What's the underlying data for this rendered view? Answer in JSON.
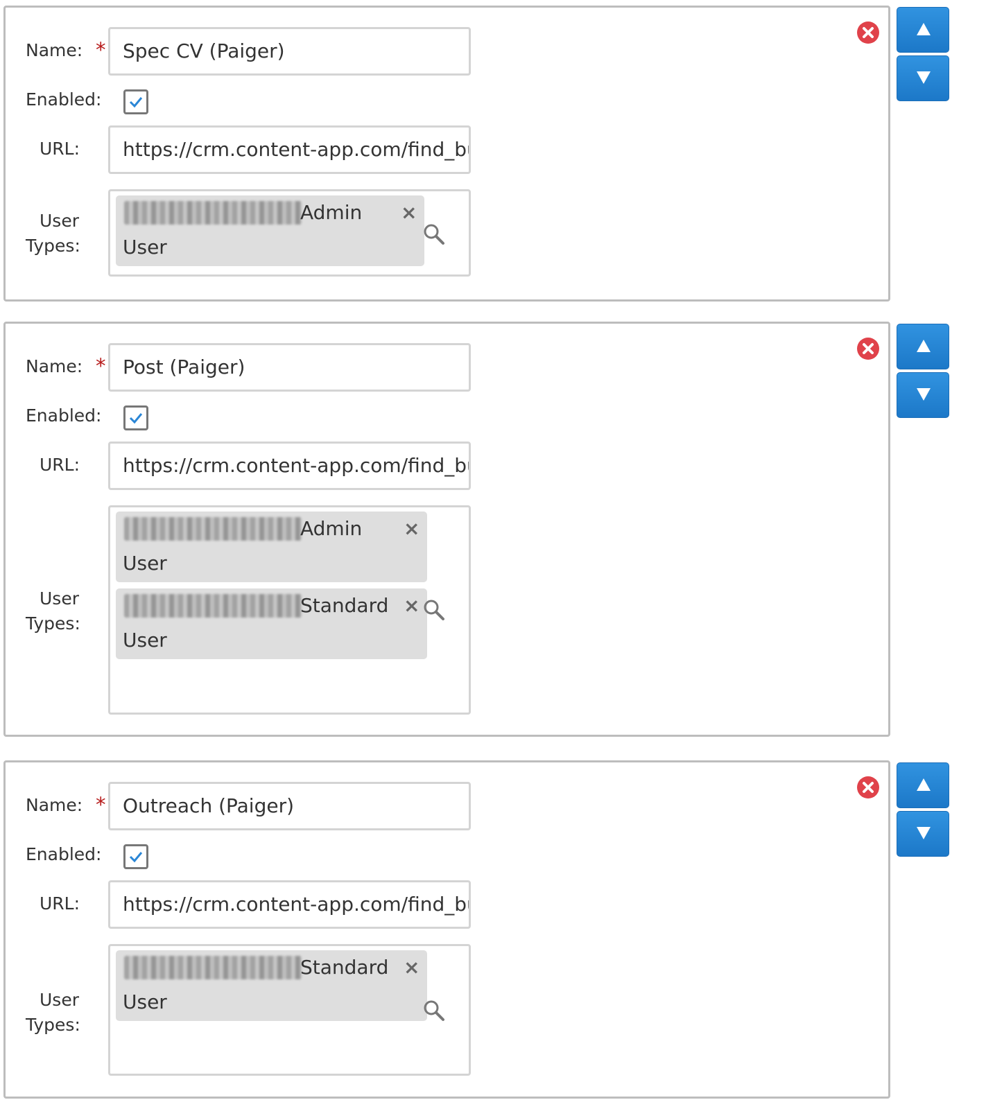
{
  "labels": {
    "name": "Name:",
    "enabled": "Enabled:",
    "url": "URL:",
    "user_types_1": "User",
    "user_types_2": "Types:",
    "required_mark": "*"
  },
  "icons": {
    "delete": "delete-circle-icon",
    "move_up": "triangle-up-icon",
    "move_down": "triangle-down-icon",
    "search": "search-icon",
    "remove_tag": "close-icon",
    "checkbox": "checkmark-icon"
  },
  "colors": {
    "accent_blue": "#2a86d6",
    "delete_red": "#e0424a",
    "required_red": "#b71c1c",
    "check_blue": "#2a86d6",
    "tag_bg": "#dedede"
  },
  "entries": [
    {
      "name": "Spec CV (Paiger)",
      "enabled": true,
      "url": "https://crm.content-app.com/find_bu",
      "user_types": [
        {
          "line1": "Admin",
          "line2": "User",
          "remove": "×"
        }
      ]
    },
    {
      "name": "Post (Paiger)",
      "enabled": true,
      "url": "https://crm.content-app.com/find_bu",
      "user_types": [
        {
          "line1": "Admin",
          "line2": "User",
          "remove": "×"
        },
        {
          "line1": "Standard",
          "line2": "User",
          "remove": "×"
        }
      ]
    },
    {
      "name": "Outreach (Paiger)",
      "enabled": true,
      "url": "https://crm.content-app.com/find_bu",
      "user_types": [
        {
          "line1": "Standard",
          "line2": "User",
          "remove": "×"
        }
      ]
    }
  ]
}
